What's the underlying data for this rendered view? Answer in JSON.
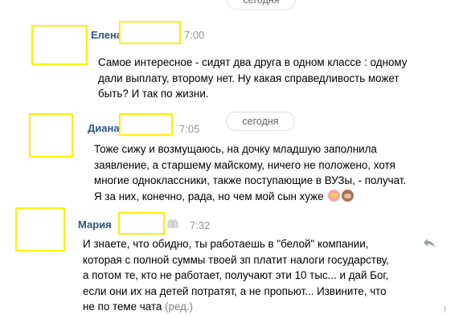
{
  "date_separators": [
    "сегодня",
    "сегодня"
  ],
  "messages": [
    {
      "author": "Елена",
      "time": "7:00",
      "lines": [
        "Самое интересное - сидят два друга в одном классе : одному",
        "дали выплату, второму нет. Ну какая справедливость может",
        "быть? И так по жизни."
      ]
    },
    {
      "author": "Диана",
      "time": "7:05",
      "lines": [
        "Тоже сижу и возмущаюсь, на дочку младшую заполнила",
        "заявление, а старшему майскому, ничего не положено, хотя",
        "многие одноклассники, также поступающие в ВУЗы, - получат.",
        "Я за них, конечно, рада, но чем мой сын хуже"
      ],
      "emojis": [
        "person-tipping-hand-emoji",
        "see-no-evil-monkey-emoji"
      ]
    },
    {
      "author": "Мария",
      "time": "7:32",
      "lines": [
        "И знаете, что обидно, ты работаешь в \"белой\" компании,",
        "которая с полной суммы твоей зп платит налоги государству,",
        "а потом те, кто не работает, получают эти 10 тыс... и дай Бог,",
        "если они их на детей потратят, а не пропьют... Извините, что",
        "не по теме чата"
      ],
      "edited_label": "(ред.)"
    }
  ],
  "icons": {
    "gift": "gift-icon",
    "reply": "reply-icon"
  },
  "colors": {
    "author_name": "#2a5885",
    "timestamp": "#939393",
    "redaction_border": "#ffee00"
  }
}
